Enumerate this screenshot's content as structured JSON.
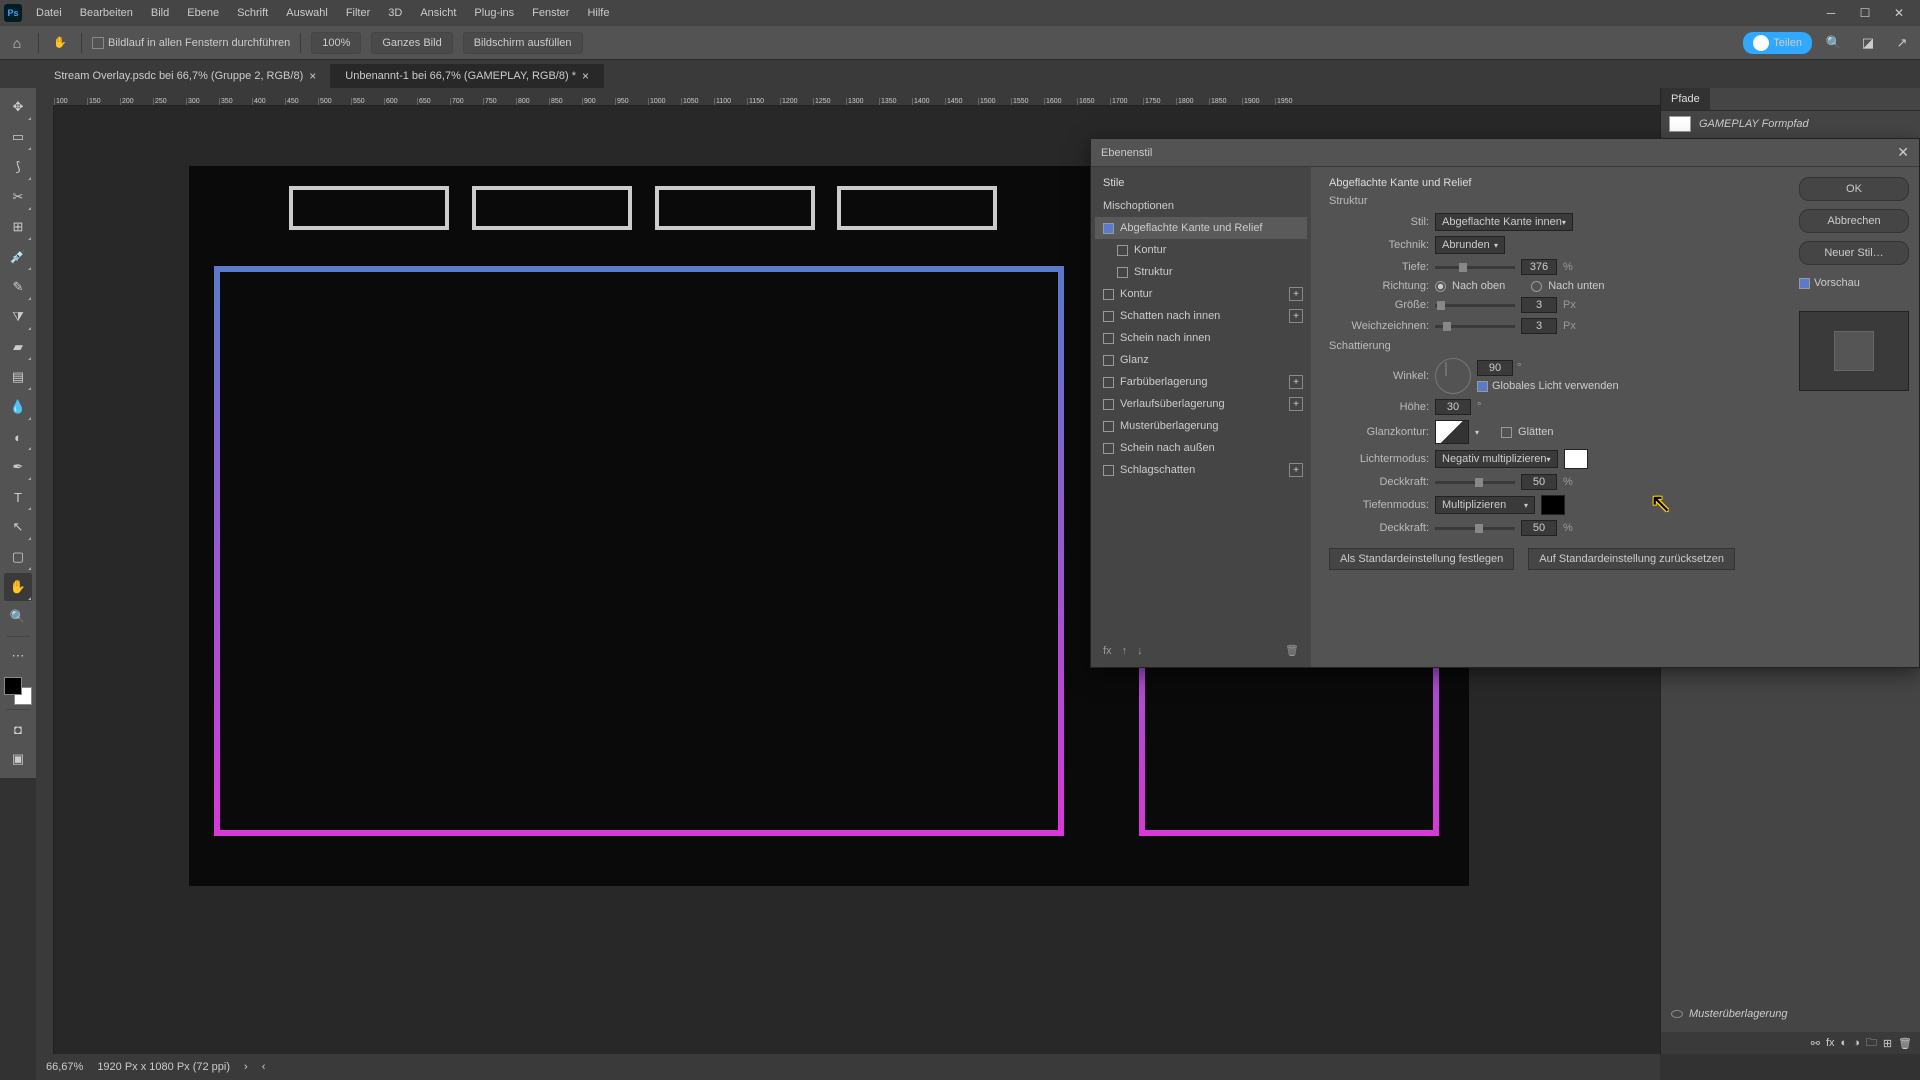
{
  "app": {
    "icon": "Ps"
  },
  "menu": [
    "Datei",
    "Bearbeiten",
    "Bild",
    "Ebene",
    "Schrift",
    "Auswahl",
    "Filter",
    "3D",
    "Ansicht",
    "Plug-ins",
    "Fenster",
    "Hilfe"
  ],
  "options": {
    "scroll_all": "Bildlauf in allen Fenstern durchführen",
    "zoom": "100%",
    "fit": "Ganzes Bild",
    "fill": "Bildschirm ausfüllen",
    "share": "Teilen"
  },
  "tabs": [
    {
      "label": "Stream Overlay.psdc bei 66,7% (Gruppe 2, RGB/8)",
      "active": false
    },
    {
      "label": "Unbenannt-1 bei 66,7% (GAMEPLAY, RGB/8) *",
      "active": true
    }
  ],
  "ruler_ticks": [
    "100",
    "150",
    "200",
    "250",
    "300",
    "350",
    "400",
    "450",
    "500",
    "550",
    "600",
    "650",
    "700",
    "750",
    "800",
    "850",
    "900",
    "950",
    "1000",
    "1050",
    "1100",
    "1150",
    "1200",
    "1250",
    "1300",
    "1350",
    "1400",
    "1450",
    "1500",
    "1550",
    "1600",
    "1650",
    "1700",
    "1750",
    "1800",
    "1850",
    "1900",
    "1950"
  ],
  "right_panel": {
    "tab": "Pfade",
    "path_name": "GAMEPLAY Formpfad",
    "hidden_item": "Musterüberlagerung"
  },
  "status": {
    "zoom": "66,67%",
    "doc": "1920 Px x 1080 Px (72 ppi)"
  },
  "dialog": {
    "title": "Ebenenstil",
    "left": {
      "head": "Stile",
      "mix": "Mischoptionen",
      "items": [
        {
          "label": "Abgeflachte Kante und Relief",
          "checked": true,
          "active": true
        },
        {
          "label": "Kontur",
          "sub": true
        },
        {
          "label": "Struktur",
          "sub": true
        },
        {
          "label": "Kontur",
          "plus": true
        },
        {
          "label": "Schatten nach innen",
          "plus": true
        },
        {
          "label": "Schein nach innen"
        },
        {
          "label": "Glanz"
        },
        {
          "label": "Farbüberlagerung",
          "plus": true
        },
        {
          "label": "Verlaufsüberlagerung",
          "plus": true
        },
        {
          "label": "Musterüberlagerung"
        },
        {
          "label": "Schein nach außen"
        },
        {
          "label": "Schlagschatten",
          "plus": true
        }
      ]
    },
    "mid": {
      "title": "Abgeflachte Kante und Relief",
      "struktur": "Struktur",
      "stil_lbl": "Stil:",
      "stil_val": "Abgeflachte Kante innen",
      "technik_lbl": "Technik:",
      "technik_val": "Abrunden",
      "tiefe_lbl": "Tiefe:",
      "tiefe_val": "376",
      "pct": "%",
      "richtung_lbl": "Richtung:",
      "oben": "Nach oben",
      "unten": "Nach unten",
      "groesse_lbl": "Größe:",
      "groesse_val": "3",
      "px": "Px",
      "weich_lbl": "Weichzeichnen:",
      "weich_val": "3",
      "schattierung": "Schattierung",
      "winkel_lbl": "Winkel:",
      "winkel_val": "90",
      "deg": "°",
      "global": "Globales Licht verwenden",
      "hoehe_lbl": "Höhe:",
      "hoehe_val": "30",
      "glanz_lbl": "Glanzkontur:",
      "glaetten": "Glätten",
      "lichter_lbl": "Lichtermodus:",
      "lichter_val": "Negativ multiplizieren",
      "deck_lbl": "Deckkraft:",
      "deck1_val": "50",
      "tiefen_lbl": "Tiefenmodus:",
      "tiefen_val": "Multiplizieren",
      "deck2_val": "50",
      "btn_default": "Als Standardeinstellung festlegen",
      "btn_reset": "Auf Standardeinstellung zurücksetzen"
    },
    "right": {
      "ok": "OK",
      "cancel": "Abbrechen",
      "new_style": "Neuer Stil…",
      "preview": "Vorschau"
    }
  }
}
